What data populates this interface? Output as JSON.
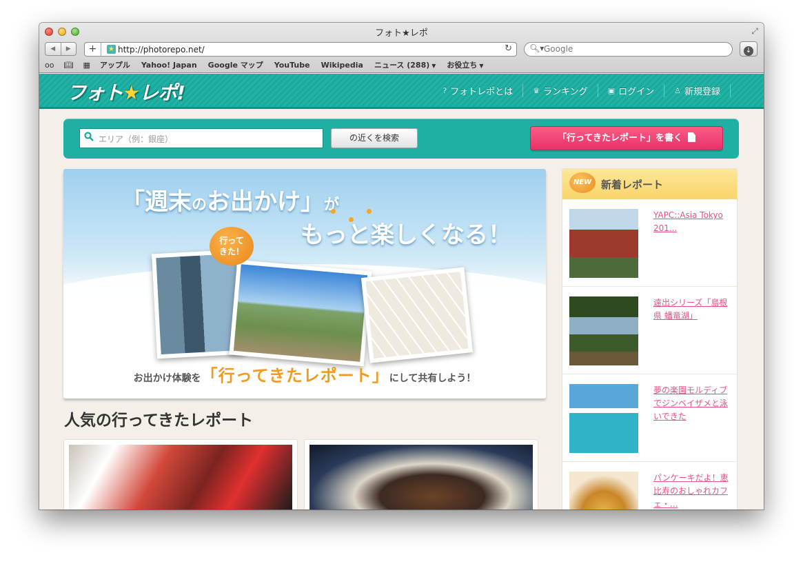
{
  "window": {
    "title": "フォト★レポ"
  },
  "browser": {
    "url": "http://photorepo.net/",
    "search_placeholder": "Google",
    "bookmarks": [
      "アップル",
      "Yahoo! Japan",
      "Google マップ",
      "YouTube",
      "Wikipedia",
      "ニュース (288)",
      "お役立ち"
    ]
  },
  "site": {
    "logo": {
      "part1": "フォト",
      "star": "★",
      "part2": "レポ!"
    },
    "nav": [
      "フォトレポとは",
      "ランキング",
      "ログイン",
      "新規登録"
    ],
    "search": {
      "placeholder": "エリア（例：銀座）",
      "near_button": "の近くを検索",
      "write_button": "「行ってきたレポート」を書く"
    },
    "hero": {
      "title_a": "「週末",
      "title_b": "の",
      "title_c": "お出かけ」",
      "title_d": "が",
      "title_e": "もっと楽しくなる！",
      "bubble_line1": "行って",
      "bubble_line2": "きた！",
      "caption_pre": "お出かけ体験を",
      "caption_big": "「行ってきたレポート」",
      "caption_post": "にして共有しよう！"
    },
    "popular_title": "人気の行ってきたレポート",
    "sidebar": {
      "badge": "NEW",
      "title": "新着レポート",
      "items": [
        {
          "title": "YAPC::Asia Tokyo 201..."
        },
        {
          "title": "遠出シリーズ「島根県 蟠竜湖」"
        },
        {
          "title": "夢の楽園モルディブでジンベイザメと泳いできた"
        },
        {
          "title": "パンケーキだよ！恵比寿のおしゃれカフェ・..."
        }
      ]
    }
  },
  "colors": {
    "teal": "#1fb0a3",
    "pink": "#e8326a",
    "orange": "#f29a20",
    "link": "#e94f86"
  }
}
